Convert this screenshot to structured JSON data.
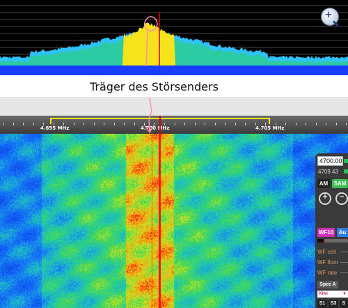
{
  "spectrum": {
    "colors": {
      "background": "#000000",
      "baseline": "#1a3cff",
      "fill": "#2fc2ff",
      "peak": "#f7e31b",
      "carrier": "#e80000"
    }
  },
  "zoom_icon": {
    "name": "zoom-in-icon",
    "symbol": "+"
  },
  "annotation": {
    "caption": "Träger des Störsenders",
    "marker_color": "#ff8fb0"
  },
  "frequency_scale": {
    "labels": [
      "4.695 MHz",
      "4.700 MHz",
      "4.705 MHz"
    ],
    "passband_color": "#f3e600"
  },
  "waterfall": {
    "colors": {
      "low": "#1a3cff",
      "mid": "#22c99a",
      "high": "#e4e91c",
      "peak": "#ff3a00"
    }
  },
  "control_panel": {
    "freq_input_value": "4700.00",
    "freq_readout": "4709.43",
    "modes": [
      "AM",
      "SAM"
    ],
    "zoom_in_symbol": "+",
    "zoom_out_symbol": "−",
    "wf_button": "WF10",
    "wf_auto_button": "Au",
    "wf_labels": [
      "WF ceil",
      "WF floor",
      "WF rate"
    ],
    "spec_button": "Spec A",
    "kiwi_select_value": "Kiwi",
    "s_buttons": [
      "S1",
      "S3",
      "S"
    ]
  }
}
